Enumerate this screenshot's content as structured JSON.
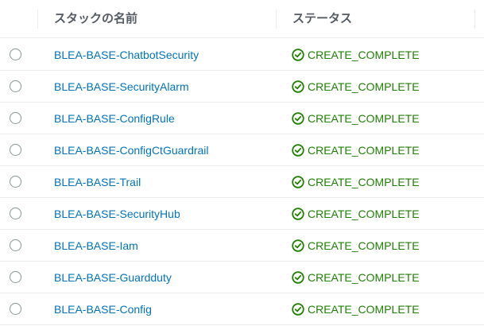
{
  "table": {
    "columns": {
      "name": "スタックの名前",
      "status": "ステータス"
    },
    "status_icon": "check-circle-icon",
    "colors": {
      "link": "#0073bb",
      "success": "#1d8102",
      "header_text": "#545b64",
      "border": "#eaeded"
    },
    "rows": [
      {
        "name": "BLEA-BASE-ChatbotSecurity",
        "status": "CREATE_COMPLETE"
      },
      {
        "name": "BLEA-BASE-SecurityAlarm",
        "status": "CREATE_COMPLETE"
      },
      {
        "name": "BLEA-BASE-ConfigRule",
        "status": "CREATE_COMPLETE"
      },
      {
        "name": "BLEA-BASE-ConfigCtGuardrail",
        "status": "CREATE_COMPLETE"
      },
      {
        "name": "BLEA-BASE-Trail",
        "status": "CREATE_COMPLETE"
      },
      {
        "name": "BLEA-BASE-SecurityHub",
        "status": "CREATE_COMPLETE"
      },
      {
        "name": "BLEA-BASE-Iam",
        "status": "CREATE_COMPLETE"
      },
      {
        "name": "BLEA-BASE-Guardduty",
        "status": "CREATE_COMPLETE"
      },
      {
        "name": "BLEA-BASE-Config",
        "status": "CREATE_COMPLETE"
      }
    ]
  }
}
